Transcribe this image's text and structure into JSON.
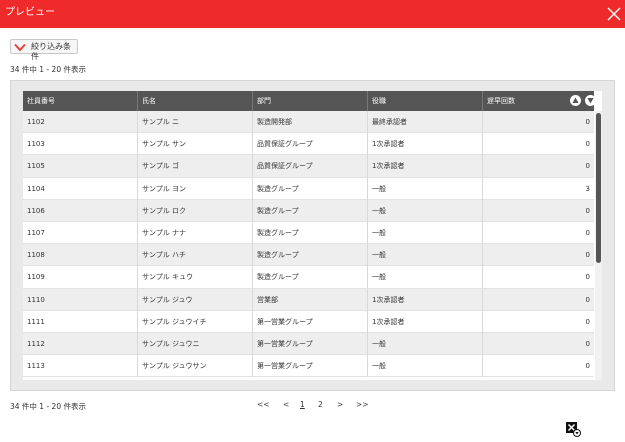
{
  "window": {
    "title": "プレビュー"
  },
  "filter": {
    "label": "絞り込み条件"
  },
  "summary": {
    "top": "34 件中 1 - 20 件表示",
    "bottom": "34 件中 1 - 20 件表示"
  },
  "table": {
    "columns": [
      "社員番号",
      "氏名",
      "部門",
      "役職",
      "遅早回数"
    ],
    "rows": [
      [
        "1102",
        "サンプル ニ",
        "製造開発部",
        "最終承認者",
        "0"
      ],
      [
        "1103",
        "サンプル サン",
        "品質保証グループ",
        "1次承認者",
        "0"
      ],
      [
        "1105",
        "サンプル ゴ",
        "品質保証グループ",
        "1次承認者",
        "0"
      ],
      [
        "1104",
        "サンプル ヨン",
        "製造グループ",
        "一般",
        "3"
      ],
      [
        "1106",
        "サンプル ロク",
        "製造グループ",
        "一般",
        "0"
      ],
      [
        "1107",
        "サンプル ナナ",
        "製造グループ",
        "一般",
        "0"
      ],
      [
        "1108",
        "サンプル ハチ",
        "製造グループ",
        "一般",
        "0"
      ],
      [
        "1109",
        "サンプル キュウ",
        "製造グループ",
        "一般",
        "0"
      ],
      [
        "1110",
        "サンプル ジュウ",
        "営業部",
        "1次承認者",
        "0"
      ],
      [
        "1111",
        "サンプル ジュウイチ",
        "第一営業グループ",
        "1次承認者",
        "0"
      ],
      [
        "1112",
        "サンプル ジュウニ",
        "第一営業グループ",
        "一般",
        "0"
      ],
      [
        "1113",
        "サンプル ジュウサン",
        "第一営業グループ",
        "一般",
        "0"
      ]
    ]
  },
  "pagination": {
    "first": "<<",
    "prev": "<",
    "pages": [
      "1",
      "2"
    ],
    "current": "1",
    "next": ">",
    "last": ">>"
  },
  "icons": {
    "close": "close-icon",
    "filter_toggle": "chevron-down-icon",
    "sort_asc": "sort-ascending-icon",
    "sort_desc": "sort-descending-icon",
    "export": "excel-export-icon"
  },
  "colors": {
    "titlebar": "#ee2a2a",
    "header": "#555555",
    "accent": "#e53935"
  }
}
